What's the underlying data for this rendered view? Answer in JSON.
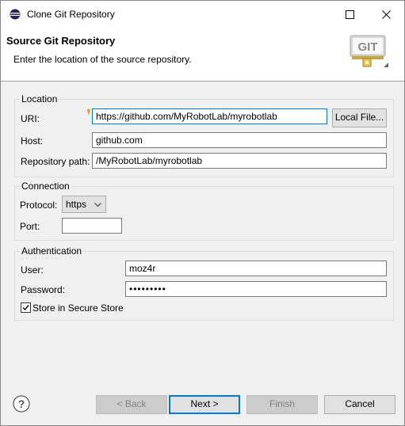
{
  "window": {
    "title": "Clone Git Repository"
  },
  "header": {
    "heading": "Source Git Repository",
    "description": "Enter the location of the source repository.",
    "logo_text": "GIT"
  },
  "location": {
    "legend": "Location",
    "uri_label": "URI:",
    "uri_value": "https://github.com/MyRobotLab/myrobotlab",
    "local_file_button": "Local File...",
    "host_label": "Host:",
    "host_value": "github.com",
    "repo_path_label": "Repository path:",
    "repo_path_value": "/MyRobotLab/myrobotlab"
  },
  "connection": {
    "legend": "Connection",
    "protocol_label": "Protocol:",
    "protocol_value": "https",
    "port_label": "Port:",
    "port_value": ""
  },
  "authentication": {
    "legend": "Authentication",
    "user_label": "User:",
    "user_value": "moz4r",
    "password_label": "Password:",
    "password_value": "•••••••••",
    "store_label": "Store in Secure Store",
    "store_checked": true
  },
  "footer": {
    "back": "< Back",
    "next": "Next >",
    "finish": "Finish",
    "cancel": "Cancel"
  },
  "colors": {
    "accent": "#0078d7",
    "tip_marker": "#e8a317"
  }
}
